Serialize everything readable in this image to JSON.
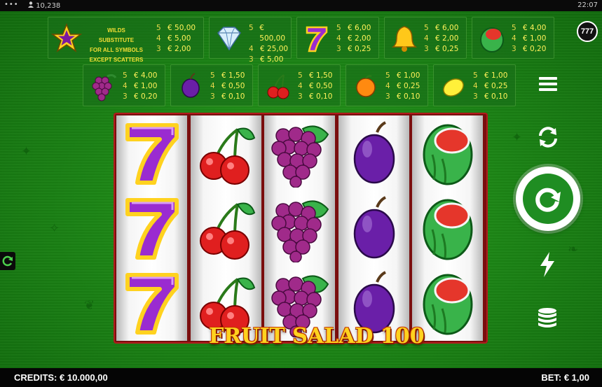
{
  "status_bar": {
    "menu": "•••",
    "user_id": "10,238",
    "time": "22:07"
  },
  "brand_badge": "777",
  "paytable": {
    "wild": {
      "icon": "star-wild-icon",
      "text": [
        "WILDS SUBSTITUTE",
        "FOR ALL SYMBOLS",
        "EXCEPT SCATTERS"
      ],
      "rows": [
        [
          "5",
          "€ 50,00"
        ],
        [
          "4",
          "€ 5,00"
        ],
        [
          "3",
          "€ 2,00"
        ]
      ]
    },
    "diamond": {
      "icon": "diamond-icon",
      "rows": [
        [
          "5",
          "€ 500,00"
        ],
        [
          "4",
          "€ 25,00"
        ],
        [
          "3",
          "€ 5,00"
        ]
      ]
    },
    "seven": {
      "icon": "seven-icon",
      "rows": [
        [
          "5",
          "€ 6,00"
        ],
        [
          "4",
          "€ 2,00"
        ],
        [
          "3",
          "€ 0,25"
        ]
      ]
    },
    "bell": {
      "icon": "bell-icon",
      "rows": [
        [
          "5",
          "€ 6,00"
        ],
        [
          "4",
          "€ 2,00"
        ],
        [
          "3",
          "€ 0,25"
        ]
      ]
    },
    "melon": {
      "icon": "watermelon-icon",
      "rows": [
        [
          "5",
          "€ 4,00"
        ],
        [
          "4",
          "€ 1,00"
        ],
        [
          "3",
          "€ 0,20"
        ]
      ]
    },
    "grapes": {
      "icon": "grapes-icon",
      "rows": [
        [
          "5",
          "€ 4,00"
        ],
        [
          "4",
          "€ 1,00"
        ],
        [
          "3",
          "€ 0,20"
        ]
      ]
    },
    "plum": {
      "icon": "plum-icon",
      "rows": [
        [
          "5",
          "€ 1,50"
        ],
        [
          "4",
          "€ 0,50"
        ],
        [
          "3",
          "€ 0,10"
        ]
      ]
    },
    "cherry": {
      "icon": "cherry-icon",
      "rows": [
        [
          "5",
          "€ 1,50"
        ],
        [
          "4",
          "€ 0,50"
        ],
        [
          "3",
          "€ 0,10"
        ]
      ]
    },
    "orange": {
      "icon": "orange-icon",
      "rows": [
        [
          "5",
          "€ 1,00"
        ],
        [
          "4",
          "€ 0,25"
        ],
        [
          "3",
          "€ 0,10"
        ]
      ]
    },
    "lemon": {
      "icon": "lemon-icon",
      "rows": [
        [
          "5",
          "€ 1,00"
        ],
        [
          "4",
          "€ 0,25"
        ],
        [
          "3",
          "€ 0,10"
        ]
      ]
    }
  },
  "reels": [
    [
      "seven",
      "seven",
      "seven"
    ],
    [
      "cherry",
      "cherry",
      "cherry"
    ],
    [
      "grapes",
      "grapes",
      "grapes"
    ],
    [
      "plum",
      "plum",
      "plum"
    ],
    [
      "watermelon",
      "watermelon",
      "watermelon"
    ]
  ],
  "game_title": "FRUIT SALAD 100",
  "controls": {
    "menu": "menu-icon",
    "autoplay": "autoplay-icon",
    "spin": "spin-icon",
    "turbo": "lightning-icon",
    "bet": "coins-stack-icon"
  },
  "footer": {
    "credits": "CREDITS: € 10.000,00",
    "bet": "BET: € 1,00"
  },
  "colors": {
    "felt": "#1d8716",
    "paytable_text": "#f6e34a",
    "reel_frame": "#7a0e0e",
    "title": "#ffd21f"
  }
}
